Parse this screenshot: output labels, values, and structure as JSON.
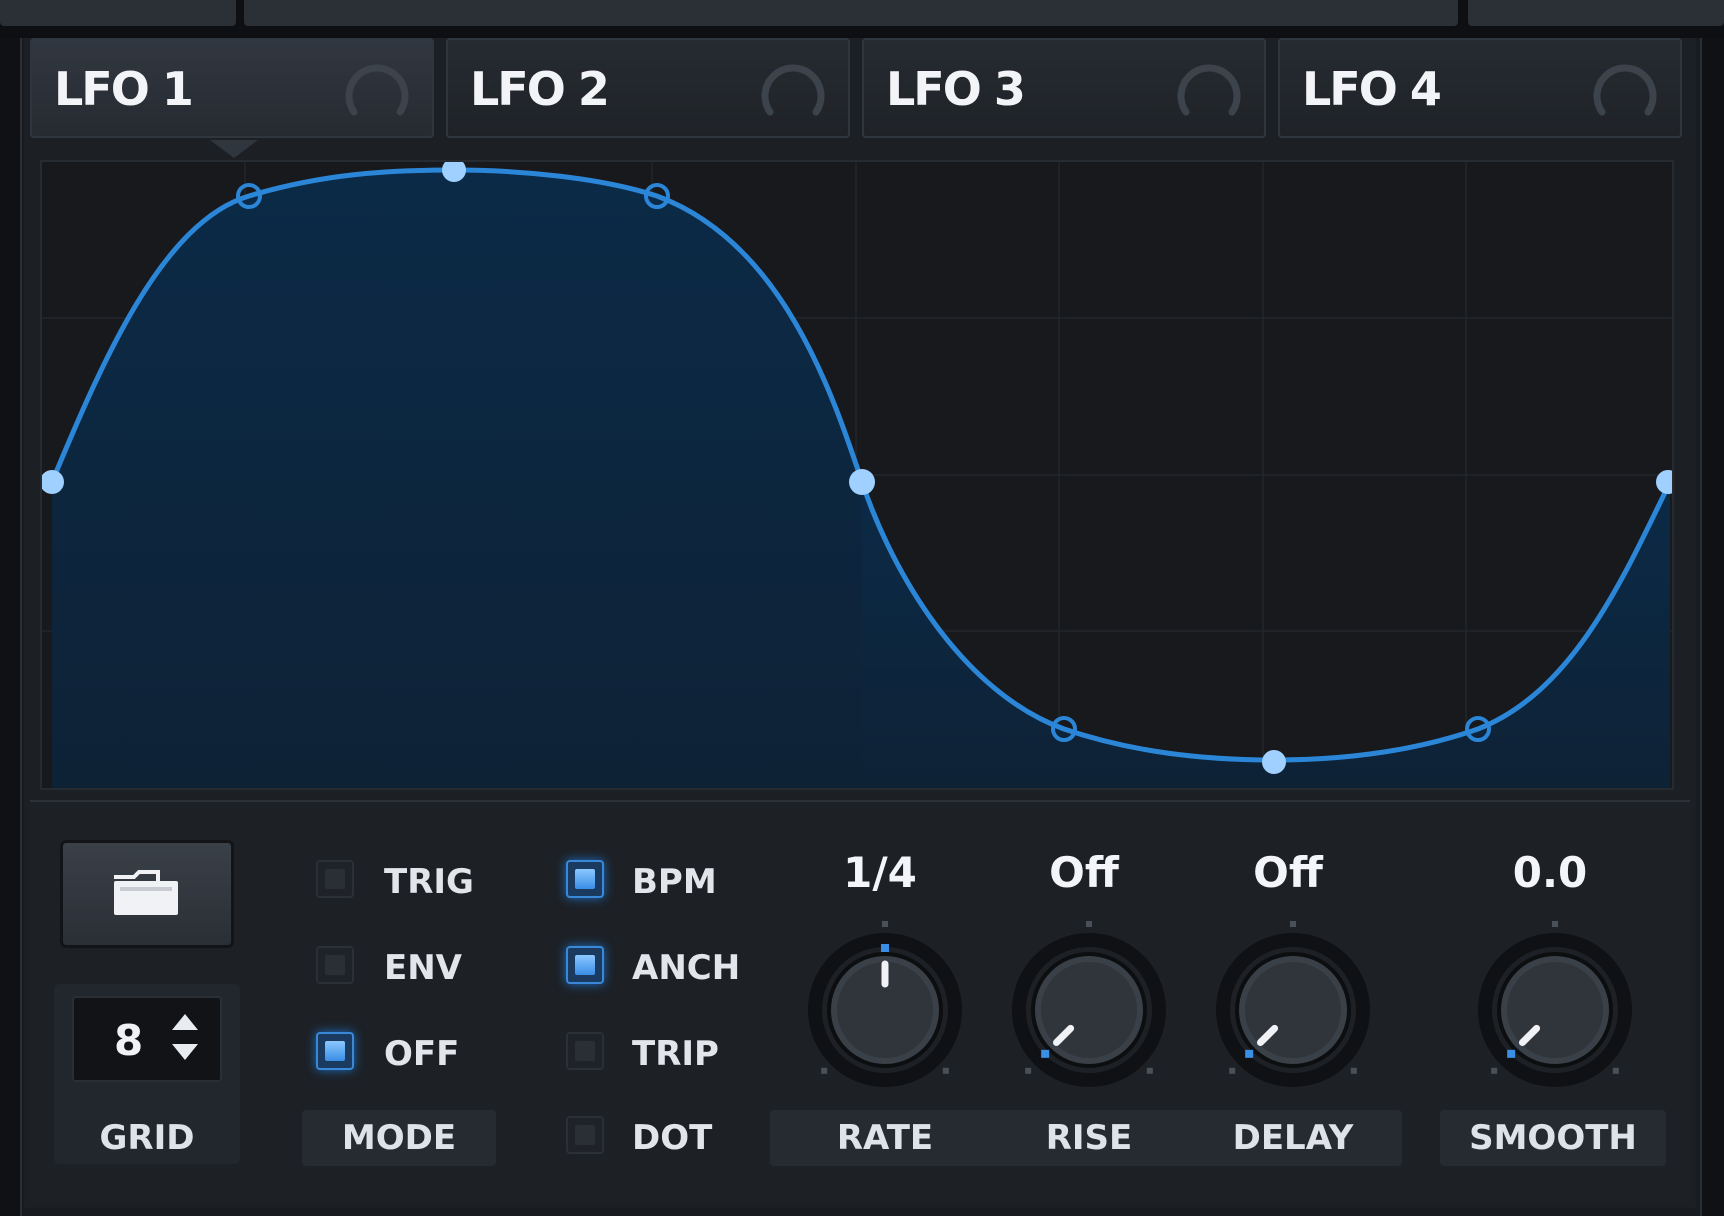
{
  "tabs": [
    {
      "label": "LFO 1",
      "active": true
    },
    {
      "label": "LFO 2",
      "active": false
    },
    {
      "label": "LFO 3",
      "active": false
    },
    {
      "label": "LFO 4",
      "active": false
    }
  ],
  "graph": {
    "curve_color": "#2b86d8",
    "fill_color": "#0b2e4d",
    "point_color": "#9fd0ff"
  },
  "grid": {
    "value": "8",
    "label": "GRID"
  },
  "mode": {
    "label": "MODE",
    "options": [
      {
        "label": "TRIG",
        "on": false
      },
      {
        "label": "ENV",
        "on": false
      },
      {
        "label": "OFF",
        "on": true
      }
    ]
  },
  "options2": [
    {
      "label": "BPM",
      "on": true
    },
    {
      "label": "ANCH",
      "on": true
    },
    {
      "label": "TRIP",
      "on": false
    },
    {
      "label": "DOT",
      "on": false
    }
  ],
  "knobs": [
    {
      "name": "RATE",
      "value": "1/4",
      "level": 0.5
    },
    {
      "name": "RISE",
      "value": "Off",
      "level": 0.0
    },
    {
      "name": "DELAY",
      "value": "Off",
      "level": 0.0
    },
    {
      "name": "SMOOTH",
      "value": "0.0",
      "level": 0.0
    }
  ],
  "colors": {
    "accent": "#2b86d8",
    "led_on": "#5aaeff"
  }
}
